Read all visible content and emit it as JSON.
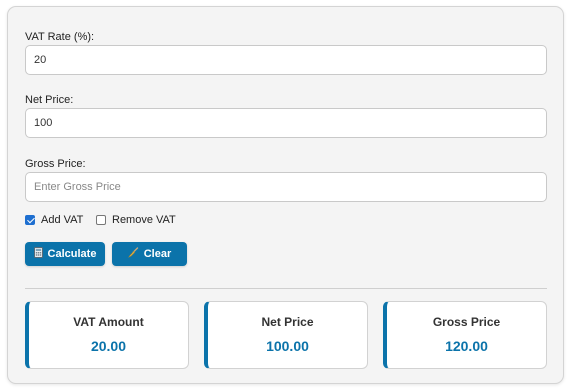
{
  "form": {
    "vat_rate": {
      "label": "VAT Rate (%):",
      "value": "20"
    },
    "net_price": {
      "label": "Net Price:",
      "value": "100"
    },
    "gross_price": {
      "label": "Gross Price:",
      "value": "",
      "placeholder": "Enter Gross Price"
    }
  },
  "options": {
    "add_vat": {
      "label": "Add VAT",
      "checked": true
    },
    "remove_vat": {
      "label": "Remove VAT",
      "checked": false
    }
  },
  "buttons": {
    "calculate": {
      "label": "Calculate",
      "icon": "calculator-icon"
    },
    "clear": {
      "label": "Clear",
      "icon": "broom-icon"
    }
  },
  "results": {
    "vat_amount": {
      "title": "VAT Amount",
      "value": "20.00"
    },
    "net_price": {
      "title": "Net Price",
      "value": "100.00"
    },
    "gross_price": {
      "title": "Gross Price",
      "value": "120.00"
    }
  },
  "colors": {
    "accent": "#0b73aa",
    "checkbox": "#1e6fd0",
    "card_background": "#f4f4f4"
  }
}
